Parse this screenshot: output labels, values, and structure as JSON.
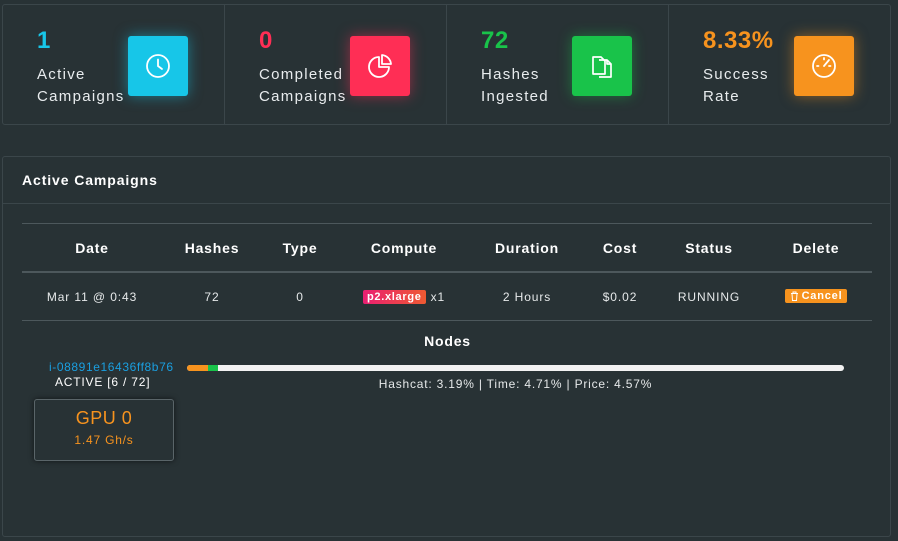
{
  "stats": [
    {
      "value": "1",
      "label": "Active\nCampaigns",
      "color": "#17c6e8",
      "icon": "clock-icon"
    },
    {
      "value": "0",
      "label": "Completed\nCampaigns",
      "color": "#ff2e55",
      "icon": "pie-chart-icon"
    },
    {
      "value": "72",
      "label": "Hashes\nIngested",
      "color": "#19c34a",
      "icon": "copy-files-icon"
    },
    {
      "value": "8.33%",
      "label": "Success\nRate",
      "color": "#f7931e",
      "icon": "gauge-icon"
    }
  ],
  "panel": {
    "title": "Active Campaigns"
  },
  "table": {
    "headers": [
      "Date",
      "Hashes",
      "Type",
      "Compute",
      "Duration",
      "Cost",
      "Status",
      "Delete"
    ],
    "row": {
      "date": "Mar 11 @ 0:43",
      "hashes": "72",
      "type": "0",
      "instance": "p2.xlarge",
      "instance_count": "x1",
      "duration": "2 Hours",
      "cost": "$0.02",
      "status": "RUNNING",
      "cancel_label": "Cancel"
    }
  },
  "nodes": {
    "title": "Nodes",
    "node_id": "i-08891e16436ff8b76",
    "state": "ACTIVE [6 / 72]",
    "progress": {
      "hashcat": 3.19,
      "time": 4.71,
      "price": 4.57
    },
    "progress_text": "Hashcat: 3.19% | Time: 4.71% | Price: 4.57%",
    "gpu": {
      "name": "GPU 0",
      "rate": "1.47 Gh/s"
    }
  },
  "colors": {
    "background": "#283235",
    "accent_orange": "#f7931e",
    "link_blue": "#1a9fe0"
  }
}
